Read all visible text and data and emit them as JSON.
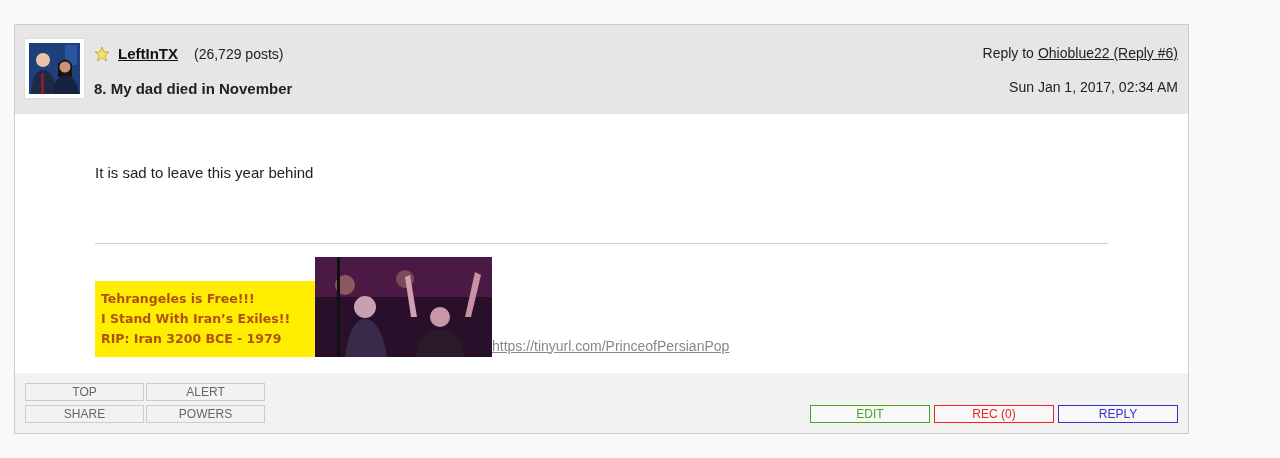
{
  "post": {
    "author": "LeftInTX",
    "starred": true,
    "post_count": "(26,729 posts)",
    "title": "8. My dad died in November",
    "reply_to_label": "Reply to",
    "reply_to_link": "Ohioblue22 (Reply #6)",
    "date": "Sun Jan 1, 2017, 02:34 AM"
  },
  "body": {
    "text": "It is sad to leave this year behind"
  },
  "signature": {
    "banner_lines": [
      "Tehrangeles is Free!!!",
      "I Stand With Iran’s Exiles!!",
      "RIP: Iran 3200 BCE - 1979"
    ],
    "link": "https://tinyurl.com/PrinceofPersianPop"
  },
  "footer": {
    "left_buttons": [
      [
        "TOP",
        "ALERT"
      ],
      [
        "SHARE",
        "POWERS"
      ]
    ],
    "right_buttons": [
      {
        "label": "EDIT",
        "color": "#44aa22"
      },
      {
        "label": "REC (0)",
        "color": "#ee2222"
      },
      {
        "label": "REPLY",
        "color": "#3333cc"
      }
    ]
  }
}
